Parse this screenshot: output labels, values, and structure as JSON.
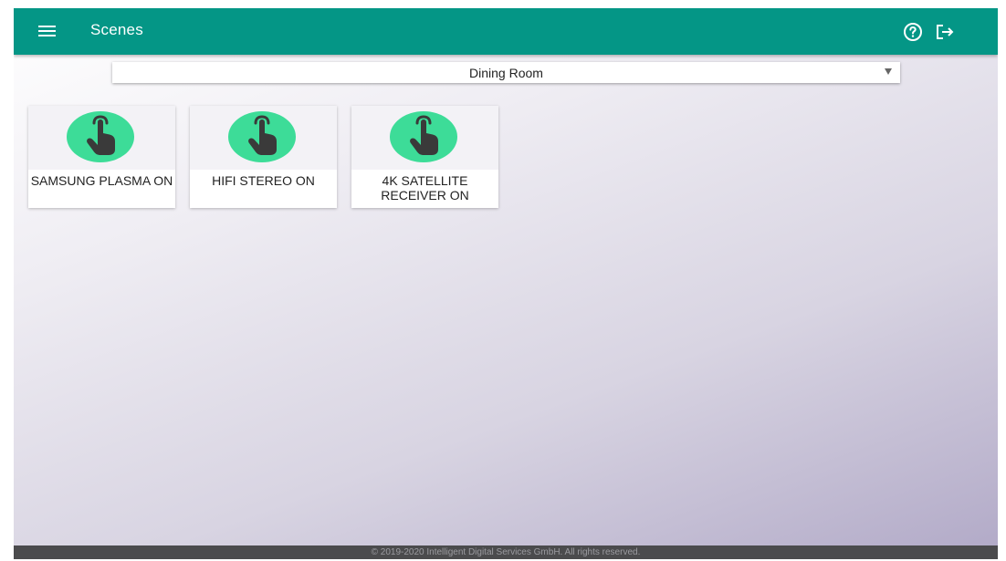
{
  "header": {
    "title": "Scenes",
    "icons": {
      "menu": "menu-icon",
      "help": "help-circle-icon",
      "logout": "logout-icon"
    }
  },
  "room_select": {
    "selected": "Dining Room"
  },
  "scenes": [
    {
      "label": "SAMSUNG PLASMA ON",
      "icon": "touch-hand-icon"
    },
    {
      "label": "HIFI STEREO ON",
      "icon": "touch-hand-icon"
    },
    {
      "label": "4K SATELLITE RECEIVER ON",
      "icon": "touch-hand-icon"
    }
  ],
  "footer": {
    "text": "© 2019-2020 Intelligent Digital Services GmbH. All rights reserved."
  },
  "colors": {
    "appbar": "#049686",
    "icon_circle": "#3ddc98",
    "hand": "#3a3a3a",
    "footer": "#4b4b4d"
  }
}
